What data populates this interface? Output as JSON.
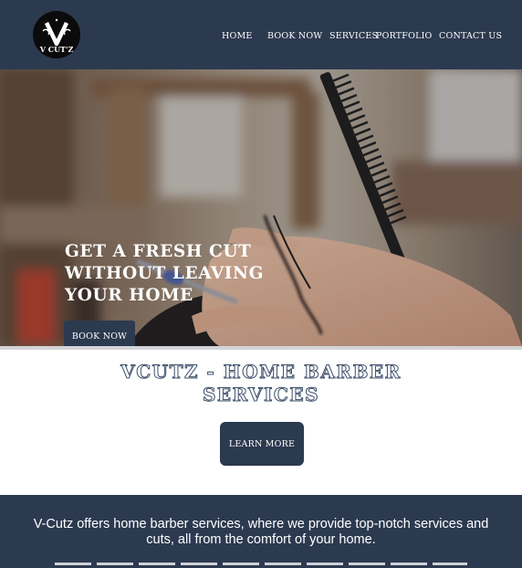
{
  "header": {
    "logo_text": "V CUT'Z",
    "nav": [
      "HOME",
      "BOOK NOW",
      "SERVICES",
      "PORTFOLIO",
      "CONTACT US"
    ]
  },
  "hero": {
    "title": "GET A FRESH CUT WITHOUT LEAVING YOUR HOME",
    "button": "BOOK NOW"
  },
  "services": {
    "title": "VCUTZ - HOME BARBER SERVICES",
    "button": "LEARN MORE"
  },
  "about": {
    "text": "V-Cutz offers home barber services, where we provide top-notch services and cuts, all from the comfort of your home."
  },
  "colors": {
    "brand_navy": "#2c3a50",
    "white": "#ffffff",
    "title_outline": "#3e4f6a"
  }
}
